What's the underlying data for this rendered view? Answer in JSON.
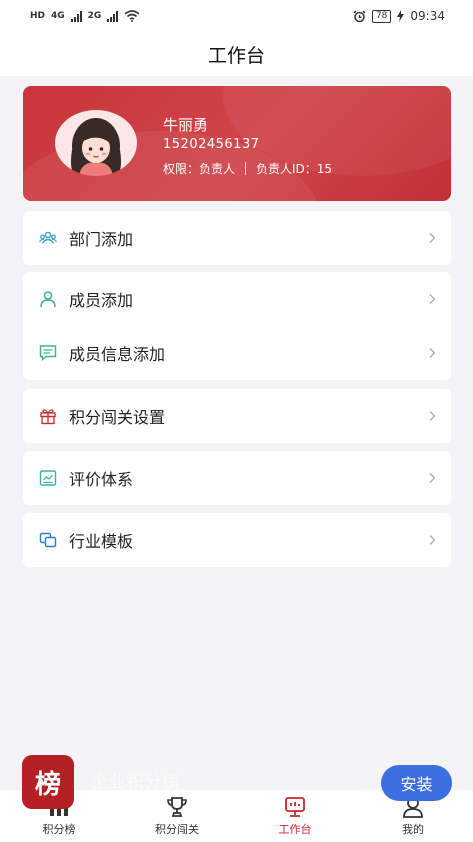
{
  "status_bar": {
    "left_badge_1": "HD",
    "signal_1_label": "4G",
    "signal_2_label": "2G",
    "battery": "78",
    "time": "09:34"
  },
  "header": {
    "title": "工作台"
  },
  "profile": {
    "name": "牛丽勇",
    "phone": "15202456137",
    "permission_label": "权限：负责人",
    "owner_id_label": "负责人ID：15"
  },
  "menu": {
    "dept_add": "部门添加",
    "member_add": "成员添加",
    "member_info_add": "成员信息添加",
    "points_level_settings": "积分闯关设置",
    "evaluation_system": "评价体系",
    "industry_template": "行业模板"
  },
  "overlay": {
    "install_label": "安装",
    "app_logo_char": "榜",
    "ghost_text": "企业积分榜"
  },
  "tabbar": {
    "tabs": [
      {
        "label": "积分榜"
      },
      {
        "label": "积分闯关"
      },
      {
        "label": "工作台"
      },
      {
        "label": "我的"
      }
    ],
    "active_index": 2,
    "active_color": "#c6262c"
  },
  "colors": {
    "brand_red": "#c9353a",
    "install_blue": "#3c6fe0",
    "icon_teal": "#3bb39a",
    "icon_red": "#c6262c"
  }
}
